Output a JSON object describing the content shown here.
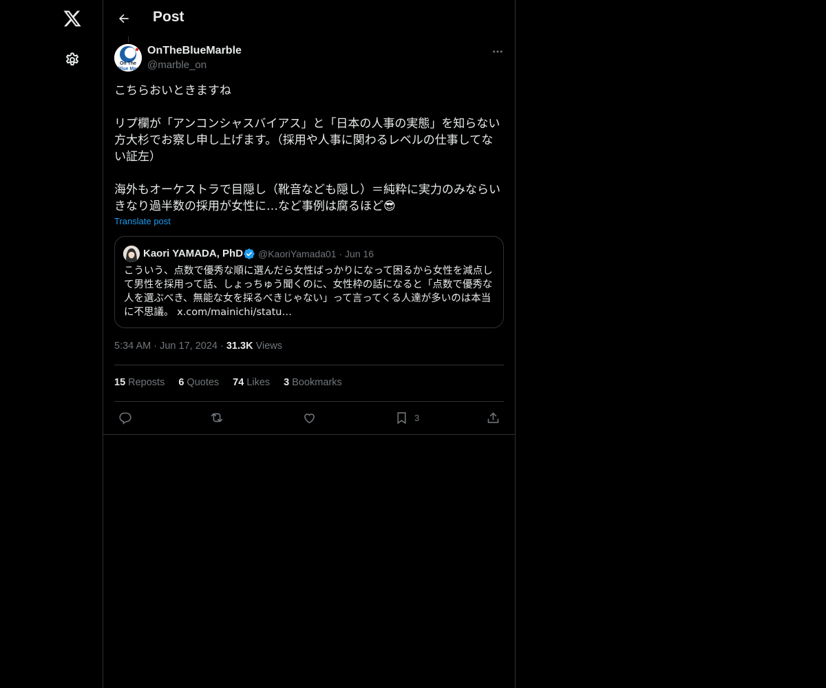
{
  "nav": {
    "logo_icon": "x-logo-icon",
    "settings_icon": "gear-icon"
  },
  "header": {
    "title": "Post",
    "back_icon": "arrow-left-icon"
  },
  "post": {
    "author_name": "OnTheBlueMarble",
    "author_handle": "@marble_on",
    "avatar_text": "On The\nBlue Marble",
    "paragraphs": [
      "こちらおいときますね",
      "リプ欄が「アンコンシャスバイアス」と「日本の人事の実態」を知らない方大杉でお察し申し上げます。（採用や人事に関わるレベルの仕事してない証左）",
      "海外もオーケストラで目隠し（靴音なども隠し）＝純粋に実力のみならいきなり過半数の採用が女性に…など事例は腐るほど😎"
    ],
    "translate_label": "Translate post",
    "time": "5:34 AM",
    "date": "Jun 17, 2024",
    "views_count": "31.3K",
    "views_label": "Views"
  },
  "quote": {
    "author_name": "Kaori YAMADA, PhD",
    "author_handle": "@KaoriYamada01",
    "date": "Jun 16",
    "text": "こういう、点数で優秀な順に選んだら女性ばっかりになって困るから女性を減点して男性を採用って話、しょっちゅう聞くのに、女性枠の話になると「点数で優秀な人を選ぶべき、無能な女を採るべきじゃない」って言ってくる人達が多いのは本当に不思議。 x.com/mainichi/statu…",
    "verified_color": "#1d9bf0"
  },
  "stats": [
    {
      "count": "15",
      "label": "Reposts"
    },
    {
      "count": "6",
      "label": "Quotes"
    },
    {
      "count": "74",
      "label": "Likes"
    },
    {
      "count": "3",
      "label": "Bookmarks"
    }
  ],
  "actions": {
    "bookmark_count": "3"
  },
  "colors": {
    "accent": "#1d9bf0",
    "text": "#e7e9ea",
    "muted": "#71767b",
    "border": "#2f3336",
    "background": "#000000"
  }
}
